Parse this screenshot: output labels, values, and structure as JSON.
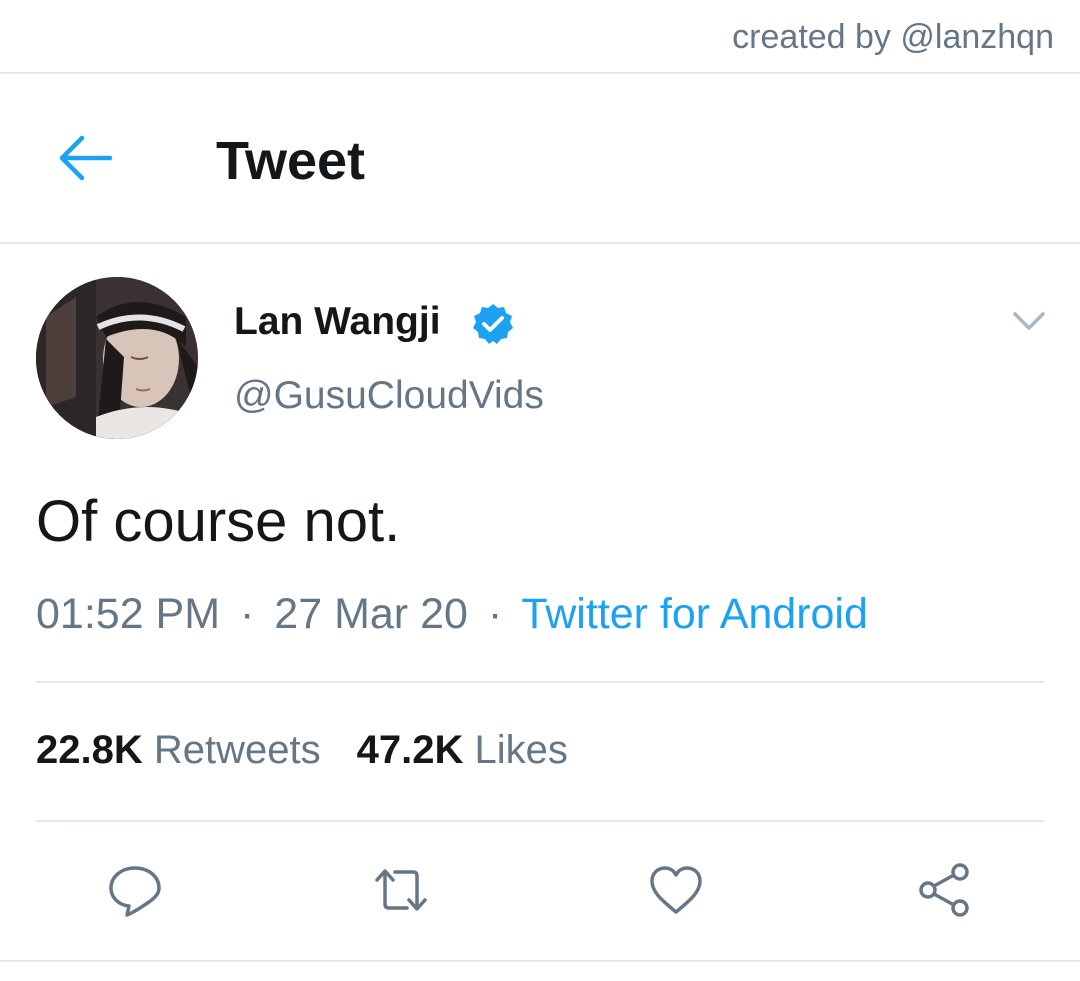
{
  "credit": "created by @lanzhqn",
  "header": {
    "title": "Tweet",
    "back_icon": "arrow-left-icon"
  },
  "tweet": {
    "user": {
      "name": "Lan Wangji",
      "handle": "@GusuCloudVids",
      "verified": true,
      "verified_icon": "verified-badge-icon"
    },
    "menu_icon": "chevron-down-icon",
    "text": "Of course not.",
    "time": "01:52 PM",
    "date": "27 Mar 20",
    "separator": "·",
    "source": "Twitter for Android",
    "stats": {
      "retweets_count": "22.8K",
      "retweets_label": "Retweets",
      "likes_count": "47.2K",
      "likes_label": "Likes"
    },
    "actions": [
      {
        "name": "reply",
        "icon": "speech-bubble-icon"
      },
      {
        "name": "retweet",
        "icon": "retweet-icon"
      },
      {
        "name": "like",
        "icon": "heart-icon"
      },
      {
        "name": "share",
        "icon": "share-icon"
      }
    ]
  },
  "colors": {
    "accent": "#1da1f2",
    "text": "#14171a",
    "secondary": "#657786",
    "divider": "#e1e8ed"
  }
}
